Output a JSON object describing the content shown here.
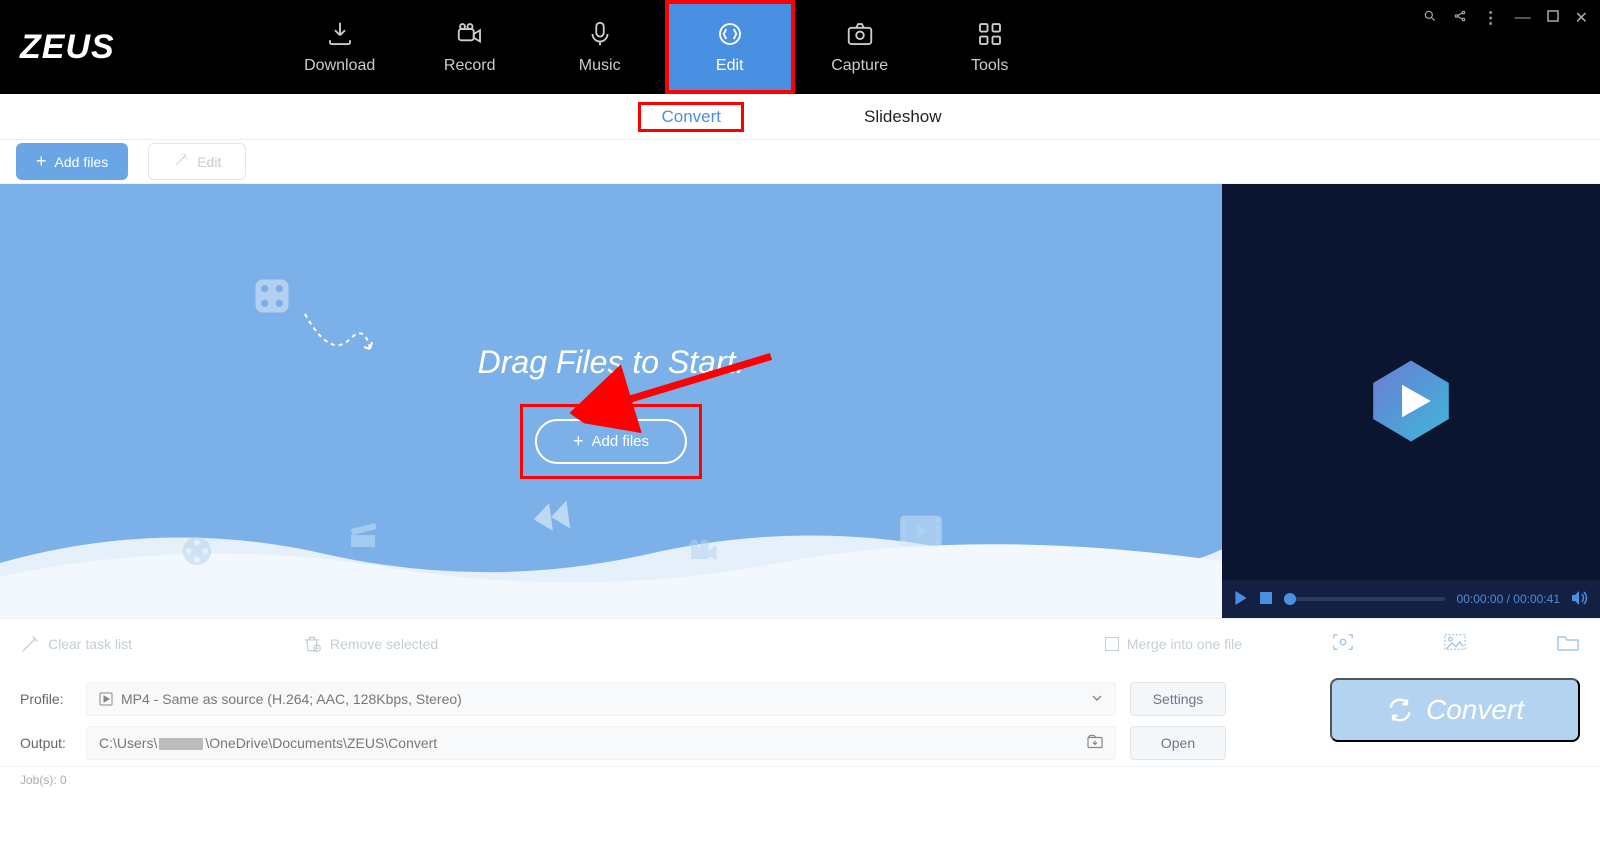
{
  "app": {
    "logo": "ZEUS"
  },
  "nav": {
    "items": [
      {
        "label": "Download"
      },
      {
        "label": "Record"
      },
      {
        "label": "Music"
      },
      {
        "label": "Edit"
      },
      {
        "label": "Capture"
      },
      {
        "label": "Tools"
      }
    ]
  },
  "subtabs": {
    "convert": "Convert",
    "slideshow": "Slideshow"
  },
  "toolbar": {
    "add_files": "Add files",
    "edit": "Edit"
  },
  "dropzone": {
    "drag_text": "Drag Files to Start.",
    "add_files": "Add files"
  },
  "preview": {
    "time_current": "00:00:00",
    "time_total": "00:00:41"
  },
  "lower": {
    "clear": "Clear task list",
    "remove": "Remove selected",
    "merge": "Merge into one file"
  },
  "profile": {
    "label": "Profile:",
    "value": "MP4 - Same as source (H.264; AAC, 128Kbps, Stereo)",
    "settings_btn": "Settings"
  },
  "output": {
    "label": "Output:",
    "value_prefix": "C:\\Users\\",
    "value_suffix": "\\OneDrive\\Documents\\ZEUS\\Convert",
    "open_btn": "Open"
  },
  "convert_btn": "Convert",
  "status": {
    "jobs_label": "Job(s): 0"
  }
}
